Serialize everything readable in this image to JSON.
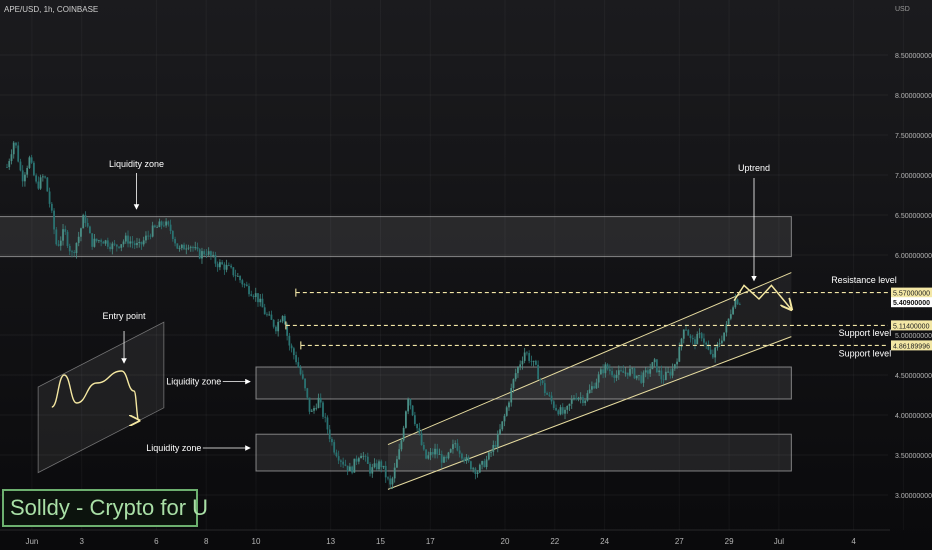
{
  "header": {
    "title": "APE/USD, 1h, COINBASE",
    "currency": "USD"
  },
  "brand": {
    "text": "Solldy - Crypto for U"
  },
  "colors": {
    "candle": "#2e8f8c",
    "zone_fill": "#ffffff",
    "zone_stroke": "#d9d9d9",
    "level_line": "#f2e6a6",
    "uptrend_arrow": "#f4e7a1",
    "annotation": "#ffffff",
    "price_tag_bg": "#f3e7a5",
    "current_tag_bg": "#ffffff"
  },
  "chart_data": {
    "type": "candlestick",
    "symbol": "APE/USD",
    "timeframe": "1h",
    "exchange": "COINBASE",
    "ylim": [
      2.85,
      9.1
    ],
    "y_ticks": [
      {
        "value": 8.5,
        "label": "8.50000000"
      },
      {
        "value": 8.0,
        "label": "8.00000000"
      },
      {
        "value": 7.5,
        "label": "7.50000000"
      },
      {
        "value": 7.0,
        "label": "7.00000000"
      },
      {
        "value": 6.5,
        "label": "6.50000000"
      },
      {
        "value": 6.0,
        "label": "6.00000000"
      },
      {
        "value": 5.0,
        "label": "5.00000000"
      },
      {
        "value": 4.5,
        "label": "4.50000000"
      },
      {
        "value": 4.0,
        "label": "4.00000000"
      },
      {
        "value": 3.5,
        "label": "3.50000000"
      },
      {
        "value": 3.0,
        "label": "3.00000000"
      }
    ],
    "x_ticks": [
      {
        "day": 1,
        "label": "Jun"
      },
      {
        "day": 3,
        "label": "3"
      },
      {
        "day": 6,
        "label": "6"
      },
      {
        "day": 8,
        "label": "8"
      },
      {
        "day": 10,
        "label": "10"
      },
      {
        "day": 13,
        "label": "13"
      },
      {
        "day": 15,
        "label": "15"
      },
      {
        "day": 17,
        "label": "17"
      },
      {
        "day": 20,
        "label": "20"
      },
      {
        "day": 22,
        "label": "22"
      },
      {
        "day": 24,
        "label": "24"
      },
      {
        "day": 27,
        "label": "27"
      },
      {
        "day": 29,
        "label": "29"
      },
      {
        "day": 31,
        "label": "Jul"
      },
      {
        "day": 34,
        "label": "4"
      },
      {
        "day": 36,
        "label": "6"
      }
    ],
    "price_path": [
      [
        0.0,
        7.1
      ],
      [
        0.3,
        7.45
      ],
      [
        0.6,
        6.95
      ],
      [
        0.9,
        7.2
      ],
      [
        1.2,
        6.85
      ],
      [
        1.5,
        7.0
      ],
      [
        1.8,
        6.5
      ],
      [
        2.0,
        6.1
      ],
      [
        2.3,
        6.3
      ],
      [
        2.6,
        6.0
      ],
      [
        2.9,
        6.25
      ],
      [
        3.1,
        6.5
      ],
      [
        3.4,
        6.15
      ],
      [
        3.8,
        6.2
      ],
      [
        4.3,
        6.1
      ],
      [
        4.8,
        6.2
      ],
      [
        5.3,
        6.1
      ],
      [
        5.8,
        6.3
      ],
      [
        6.3,
        6.4
      ],
      [
        6.6,
        6.3
      ],
      [
        6.9,
        6.05
      ],
      [
        7.3,
        6.15
      ],
      [
        7.7,
        6.0
      ],
      [
        8.0,
        6.05
      ],
      [
        8.4,
        5.9
      ],
      [
        8.8,
        5.85
      ],
      [
        9.2,
        5.75
      ],
      [
        9.6,
        5.6
      ],
      [
        10.0,
        5.5
      ],
      [
        10.4,
        5.25
      ],
      [
        10.8,
        5.1
      ],
      [
        11.1,
        5.3
      ],
      [
        11.3,
        4.9
      ],
      [
        11.6,
        4.7
      ],
      [
        11.9,
        4.4
      ],
      [
        12.2,
        4.0
      ],
      [
        12.5,
        4.2
      ],
      [
        12.8,
        3.9
      ],
      [
        13.1,
        3.6
      ],
      [
        13.4,
        3.45
      ],
      [
        13.8,
        3.3
      ],
      [
        14.2,
        3.55
      ],
      [
        14.6,
        3.3
      ],
      [
        15.0,
        3.4
      ],
      [
        15.4,
        3.1
      ],
      [
        15.8,
        3.6
      ],
      [
        16.1,
        4.25
      ],
      [
        16.5,
        3.8
      ],
      [
        16.8,
        3.45
      ],
      [
        17.2,
        3.55
      ],
      [
        17.6,
        3.4
      ],
      [
        18.0,
        3.65
      ],
      [
        18.5,
        3.4
      ],
      [
        18.9,
        3.3
      ],
      [
        19.3,
        3.45
      ],
      [
        19.7,
        3.7
      ],
      [
        20.0,
        4.0
      ],
      [
        20.4,
        4.5
      ],
      [
        20.8,
        4.8
      ],
      [
        21.2,
        4.6
      ],
      [
        21.6,
        4.3
      ],
      [
        22.0,
        4.1
      ],
      [
        22.4,
        4.0
      ],
      [
        22.8,
        4.25
      ],
      [
        23.2,
        4.2
      ],
      [
        23.6,
        4.4
      ],
      [
        24.0,
        4.6
      ],
      [
        24.5,
        4.5
      ],
      [
        25.0,
        4.55
      ],
      [
        25.5,
        4.45
      ],
      [
        26.0,
        4.65
      ],
      [
        26.3,
        4.45
      ],
      [
        26.7,
        4.55
      ],
      [
        27.0,
        4.8
      ],
      [
        27.2,
        5.15
      ],
      [
        27.5,
        4.9
      ],
      [
        27.9,
        5.0
      ],
      [
        28.3,
        4.7
      ],
      [
        28.6,
        4.9
      ],
      [
        28.9,
        5.1
      ],
      [
        29.2,
        5.45
      ],
      [
        29.5,
        5.41
      ]
    ],
    "zones": [
      {
        "x0": -0.5,
        "x1": 31.5,
        "y0": 5.98,
        "y1": 6.48,
        "label": "Liquidity zone",
        "label_pos": [
          5.2,
          7.1
        ],
        "arrow": "down"
      },
      {
        "x0": 10.0,
        "x1": 31.5,
        "y0": 4.2,
        "y1": 4.6,
        "label": "Liquidity zone",
        "label_pos": [
          7.5,
          4.38
        ],
        "arrow": "right"
      },
      {
        "x0": 10.0,
        "x1": 31.5,
        "y0": 3.3,
        "y1": 3.76,
        "label": "Liquidity zone",
        "label_pos": [
          6.7,
          3.55
        ],
        "arrow": "right"
      }
    ],
    "channel": {
      "lower": [
        [
          15.3,
          3.07
        ],
        [
          31.5,
          4.98
        ]
      ],
      "upper": [
        [
          15.3,
          3.63
        ],
        [
          31.5,
          5.78
        ]
      ]
    },
    "levels": [
      {
        "y": 5.53,
        "x0": 11.6,
        "label": "Resistance level",
        "tag": "5.57000000",
        "label_pos": [
          33.1,
          5.65
        ]
      },
      {
        "y": 5.12,
        "x0": 11.2,
        "label": "Support level",
        "tag": "5.11400000",
        "label_pos": [
          33.4,
          4.99
        ]
      },
      {
        "y": 4.87,
        "x0": 11.8,
        "label": "Support level",
        "tag": "4.86189996",
        "label_pos": [
          33.4,
          4.73
        ]
      }
    ],
    "current_price": {
      "value": 5.41,
      "tag": "5.40900000"
    },
    "projection": [
      [
        29.2,
        5.43
      ],
      [
        29.6,
        5.62
      ],
      [
        30.2,
        5.45
      ],
      [
        30.7,
        5.62
      ],
      [
        31.5,
        5.32
      ]
    ],
    "uptrend_label": {
      "text": "Uptrend",
      "pos": [
        30.0,
        7.05
      ],
      "arrow_to": [
        30.0,
        5.68
      ]
    },
    "entry_point": {
      "label": "Entry point",
      "box": [
        [
          1.25,
          3.28
        ],
        [
          6.3,
          4.09
        ],
        [
          6.3,
          5.16
        ],
        [
          1.25,
          4.35
        ]
      ],
      "path": [
        [
          1.8,
          4.1
        ],
        [
          2.3,
          4.5
        ],
        [
          2.8,
          4.15
        ],
        [
          3.6,
          4.4
        ],
        [
          4.6,
          4.55
        ],
        [
          5.1,
          4.3
        ],
        [
          5.3,
          3.93
        ]
      ],
      "label_pos": [
        4.7,
        5.2
      ],
      "arrow_from": [
        4.7,
        5.05
      ],
      "arrow_to": [
        4.7,
        4.65
      ]
    }
  }
}
